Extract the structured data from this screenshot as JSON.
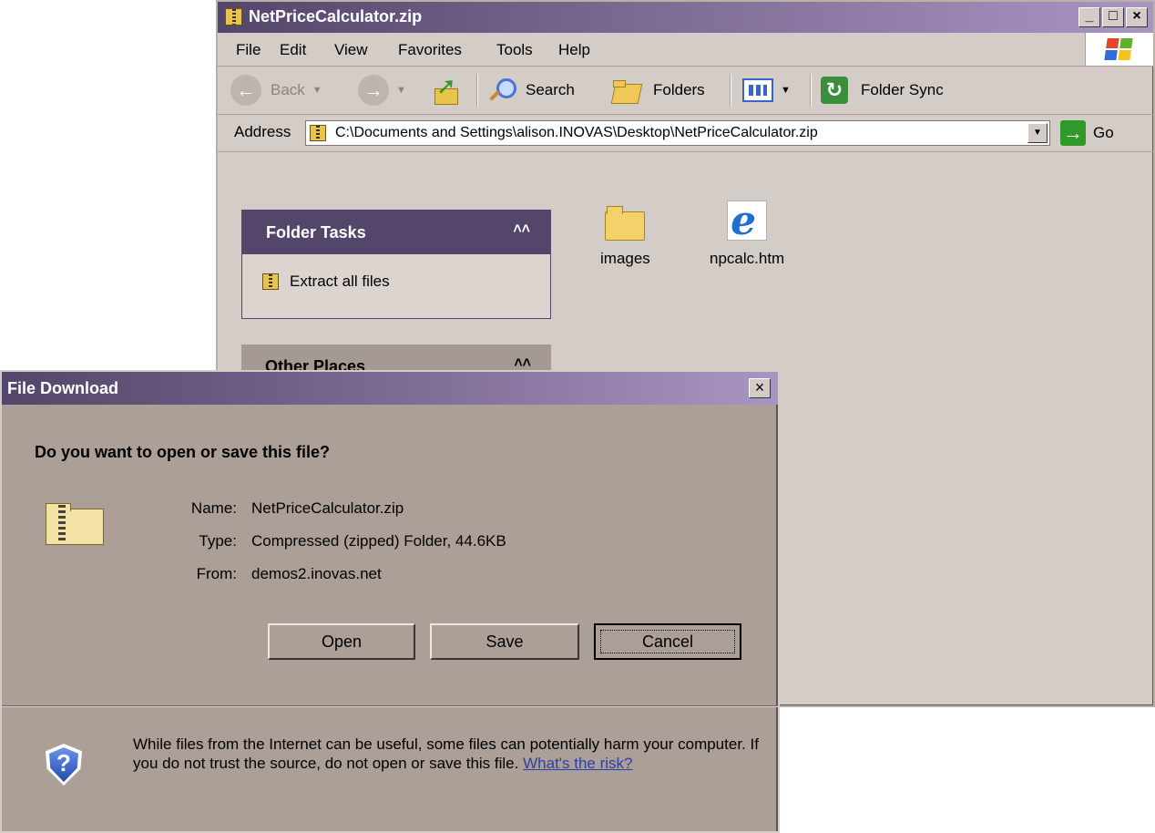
{
  "explorer": {
    "title": "NetPriceCalculator.zip",
    "window_buttons": [
      "_",
      "□",
      "×"
    ],
    "menu": [
      "File",
      "Edit",
      "View",
      "Favorites",
      "Tools",
      "Help"
    ],
    "toolbar": {
      "back": "Back",
      "search": "Search",
      "folders": "Folders",
      "folder_sync": "Folder Sync"
    },
    "address": {
      "label": "Address",
      "value": "C:\\Documents and Settings\\alison.INOVAS\\Desktop\\NetPriceCalculator.zip",
      "go": "Go"
    },
    "folder_tasks": {
      "title": "Folder Tasks",
      "chevron": "˄˄",
      "items": [
        "Extract all files"
      ]
    },
    "other_places": {
      "title": "Other Places",
      "chevron": "˄˄"
    },
    "files": [
      {
        "name": "images",
        "icon": "folder-icon"
      },
      {
        "name": "npcalc.htm",
        "icon": "ie-document-icon"
      }
    ]
  },
  "dialog": {
    "title": "File Download",
    "close": "×",
    "question": "Do you want to open or save this file?",
    "name_label": "Name:",
    "name_value": "NetPriceCalculator.zip",
    "type_label": "Type:",
    "type_value": "Compressed (zipped) Folder, 44.6KB",
    "from_label": "From:",
    "from_value": "demos2.inovas.net",
    "buttons": {
      "open": "Open",
      "save": "Save",
      "cancel": "Cancel"
    },
    "warning": "While files from the Internet can be useful, some files can potentially harm your computer. If you do not trust the source, do not open or save this file.",
    "risk_link": "What's the risk?"
  },
  "colors": {
    "titlebar_start": "#54456a",
    "titlebar_end": "#a995c2",
    "window_face": "#d4ccc6",
    "dialog_face": "#ab9f98",
    "link": "#2b3fa8"
  }
}
